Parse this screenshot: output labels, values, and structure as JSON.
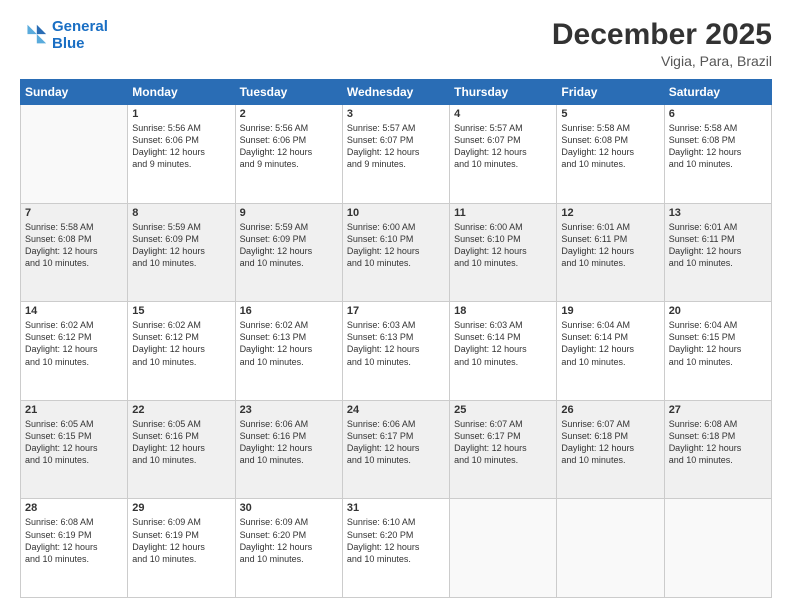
{
  "logo": {
    "line1": "General",
    "line2": "Blue"
  },
  "title": "December 2025",
  "location": "Vigia, Para, Brazil",
  "days_of_week": [
    "Sunday",
    "Monday",
    "Tuesday",
    "Wednesday",
    "Thursday",
    "Friday",
    "Saturday"
  ],
  "weeks": [
    [
      {
        "day": "",
        "info": ""
      },
      {
        "day": "1",
        "info": "Sunrise: 5:56 AM\nSunset: 6:06 PM\nDaylight: 12 hours\nand 9 minutes."
      },
      {
        "day": "2",
        "info": "Sunrise: 5:56 AM\nSunset: 6:06 PM\nDaylight: 12 hours\nand 9 minutes."
      },
      {
        "day": "3",
        "info": "Sunrise: 5:57 AM\nSunset: 6:07 PM\nDaylight: 12 hours\nand 9 minutes."
      },
      {
        "day": "4",
        "info": "Sunrise: 5:57 AM\nSunset: 6:07 PM\nDaylight: 12 hours\nand 10 minutes."
      },
      {
        "day": "5",
        "info": "Sunrise: 5:58 AM\nSunset: 6:08 PM\nDaylight: 12 hours\nand 10 minutes."
      },
      {
        "day": "6",
        "info": "Sunrise: 5:58 AM\nSunset: 6:08 PM\nDaylight: 12 hours\nand 10 minutes."
      }
    ],
    [
      {
        "day": "7",
        "info": "Sunrise: 5:58 AM\nSunset: 6:08 PM\nDaylight: 12 hours\nand 10 minutes."
      },
      {
        "day": "8",
        "info": "Sunrise: 5:59 AM\nSunset: 6:09 PM\nDaylight: 12 hours\nand 10 minutes."
      },
      {
        "day": "9",
        "info": "Sunrise: 5:59 AM\nSunset: 6:09 PM\nDaylight: 12 hours\nand 10 minutes."
      },
      {
        "day": "10",
        "info": "Sunrise: 6:00 AM\nSunset: 6:10 PM\nDaylight: 12 hours\nand 10 minutes."
      },
      {
        "day": "11",
        "info": "Sunrise: 6:00 AM\nSunset: 6:10 PM\nDaylight: 12 hours\nand 10 minutes."
      },
      {
        "day": "12",
        "info": "Sunrise: 6:01 AM\nSunset: 6:11 PM\nDaylight: 12 hours\nand 10 minutes."
      },
      {
        "day": "13",
        "info": "Sunrise: 6:01 AM\nSunset: 6:11 PM\nDaylight: 12 hours\nand 10 minutes."
      }
    ],
    [
      {
        "day": "14",
        "info": "Sunrise: 6:02 AM\nSunset: 6:12 PM\nDaylight: 12 hours\nand 10 minutes."
      },
      {
        "day": "15",
        "info": "Sunrise: 6:02 AM\nSunset: 6:12 PM\nDaylight: 12 hours\nand 10 minutes."
      },
      {
        "day": "16",
        "info": "Sunrise: 6:02 AM\nSunset: 6:13 PM\nDaylight: 12 hours\nand 10 minutes."
      },
      {
        "day": "17",
        "info": "Sunrise: 6:03 AM\nSunset: 6:13 PM\nDaylight: 12 hours\nand 10 minutes."
      },
      {
        "day": "18",
        "info": "Sunrise: 6:03 AM\nSunset: 6:14 PM\nDaylight: 12 hours\nand 10 minutes."
      },
      {
        "day": "19",
        "info": "Sunrise: 6:04 AM\nSunset: 6:14 PM\nDaylight: 12 hours\nand 10 minutes."
      },
      {
        "day": "20",
        "info": "Sunrise: 6:04 AM\nSunset: 6:15 PM\nDaylight: 12 hours\nand 10 minutes."
      }
    ],
    [
      {
        "day": "21",
        "info": "Sunrise: 6:05 AM\nSunset: 6:15 PM\nDaylight: 12 hours\nand 10 minutes."
      },
      {
        "day": "22",
        "info": "Sunrise: 6:05 AM\nSunset: 6:16 PM\nDaylight: 12 hours\nand 10 minutes."
      },
      {
        "day": "23",
        "info": "Sunrise: 6:06 AM\nSunset: 6:16 PM\nDaylight: 12 hours\nand 10 minutes."
      },
      {
        "day": "24",
        "info": "Sunrise: 6:06 AM\nSunset: 6:17 PM\nDaylight: 12 hours\nand 10 minutes."
      },
      {
        "day": "25",
        "info": "Sunrise: 6:07 AM\nSunset: 6:17 PM\nDaylight: 12 hours\nand 10 minutes."
      },
      {
        "day": "26",
        "info": "Sunrise: 6:07 AM\nSunset: 6:18 PM\nDaylight: 12 hours\nand 10 minutes."
      },
      {
        "day": "27",
        "info": "Sunrise: 6:08 AM\nSunset: 6:18 PM\nDaylight: 12 hours\nand 10 minutes."
      }
    ],
    [
      {
        "day": "28",
        "info": "Sunrise: 6:08 AM\nSunset: 6:19 PM\nDaylight: 12 hours\nand 10 minutes."
      },
      {
        "day": "29",
        "info": "Sunrise: 6:09 AM\nSunset: 6:19 PM\nDaylight: 12 hours\nand 10 minutes."
      },
      {
        "day": "30",
        "info": "Sunrise: 6:09 AM\nSunset: 6:20 PM\nDaylight: 12 hours\nand 10 minutes."
      },
      {
        "day": "31",
        "info": "Sunrise: 6:10 AM\nSunset: 6:20 PM\nDaylight: 12 hours\nand 10 minutes."
      },
      {
        "day": "",
        "info": ""
      },
      {
        "day": "",
        "info": ""
      },
      {
        "day": "",
        "info": ""
      }
    ]
  ]
}
